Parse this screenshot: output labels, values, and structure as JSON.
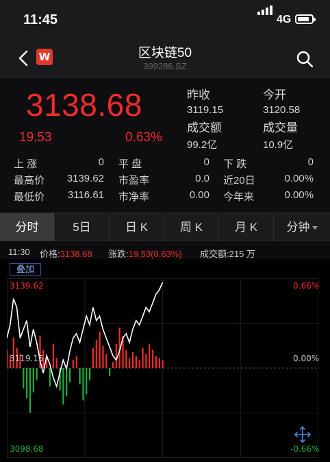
{
  "status_bar": {
    "time": "11:45",
    "network": "4G",
    "battery_level": 0.85
  },
  "header": {
    "title": "区块链50",
    "code": "399286.SZ",
    "logo_text": "W"
  },
  "quote": {
    "price": "3138.68",
    "change": "19.53",
    "change_pct": "0.63%",
    "prev_close_label": "昨收",
    "prev_close": "3119.15",
    "open_label": "今开",
    "open": "3120.58",
    "turnover_label": "成交额",
    "turnover": "99.2亿",
    "volume_label": "成交量",
    "volume": "10.9亿"
  },
  "stats": [
    [
      {
        "label": "上  涨",
        "value": "0"
      },
      {
        "label": "平  盘",
        "value": "0"
      },
      {
        "label": "下  跌",
        "value": "0"
      }
    ],
    [
      {
        "label": "最高价",
        "value": "3139.62"
      },
      {
        "label": "市盈率",
        "value": "0.0"
      },
      {
        "label": "近20日",
        "value": "0.00%"
      }
    ],
    [
      {
        "label": "最低价",
        "value": "3116.61"
      },
      {
        "label": "市净率",
        "value": "0.00"
      },
      {
        "label": "今年来",
        "value": "0.00%"
      }
    ]
  ],
  "tabs": [
    "分时",
    "5日",
    "日 K",
    "周 K",
    "月 K",
    "分钟"
  ],
  "active_tab": 0,
  "info_bar": {
    "time": "11:30",
    "price_label": "价格:",
    "price": "3138.68",
    "change_label": "涨跌:",
    "change": "19.53(0.63%)",
    "turnover_label": "成交额:",
    "turnover": "215 万"
  },
  "overlay_button": "叠加",
  "colors": {
    "up": "#f22c2c",
    "down": "#1fae3a",
    "line": "#ffffff",
    "bg": "#000000"
  },
  "chart_data": {
    "type": "line",
    "y_max_label": "3139.62",
    "y_mid_label": "3119.15",
    "y_min_label": "3098.68",
    "pct_max_label": "0.66%",
    "pct_mid_label": "0.00%",
    "pct_min_label": "-0.66%",
    "ylim": [
      3098.68,
      3139.62
    ],
    "prev_close": 3119.15,
    "price": [
      3126,
      3129,
      3135,
      3133,
      3126,
      3128,
      3130,
      3124,
      3128,
      3125,
      3121,
      3118,
      3122,
      3120,
      3117,
      3115,
      3118,
      3121,
      3119,
      3123,
      3126,
      3127,
      3125,
      3128,
      3131,
      3129,
      3133,
      3130,
      3131,
      3128,
      3126,
      3124,
      3122,
      3121,
      3123,
      3126,
      3127,
      3125,
      3128,
      3130,
      3129,
      3131,
      3133,
      3132,
      3134,
      3136,
      3137,
      3138.68
    ],
    "volume_bars": [
      9,
      6,
      15,
      10,
      7,
      -10,
      -15,
      -22,
      -12,
      -6,
      16,
      9,
      6,
      -9,
      12,
      5,
      -11,
      -18,
      -14,
      -7,
      4,
      6,
      -8,
      -16,
      -13,
      -6,
      10,
      14,
      18,
      11,
      7,
      -4,
      3,
      12,
      20,
      16,
      9,
      5,
      8,
      6,
      4,
      10,
      7,
      12,
      9,
      6,
      5,
      4
    ],
    "title": "",
    "xlabel": "",
    "ylabel": "",
    "grid": true
  }
}
